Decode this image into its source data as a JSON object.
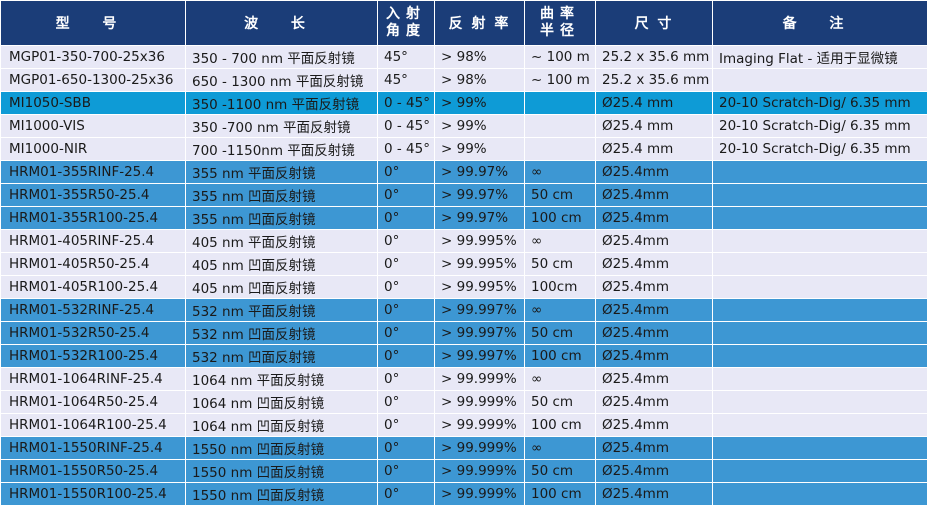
{
  "headers": [
    "型 号",
    "波 长",
    "入射角度",
    "反 射 率",
    "曲率半径",
    "尺 寸",
    "备 注"
  ],
  "header_lines": {
    "angle": [
      "入射",
      "角度"
    ],
    "curvature": [
      "曲率",
      "半径"
    ]
  },
  "rows": [
    {
      "style": "light",
      "cells": [
        "MGP01-350-700-25x36",
        "350 - 700 nm 平面反射镜",
        "45°",
        "> 98%",
        "~ 100 m",
        "25.2 x 35.6 mm",
        "Imaging Flat - 适用于显微镜"
      ]
    },
    {
      "style": "light",
      "cells": [
        "MGP01-650-1300-25x36",
        "650 - 1300 nm 平面反射镜",
        "45°",
        "> 98%",
        "~ 100 m",
        "25.2 x 35.6 mm",
        ""
      ]
    },
    {
      "style": "cyan",
      "cells": [
        "MI1050-SBB",
        "350 -1100 nm 平面反射镜",
        "0 - 45°",
        "> 99%",
        "",
        "Ø25.4 mm",
        "20-10 Scratch-Dig/ 6.35 mm"
      ]
    },
    {
      "style": "light",
      "cells": [
        "MI1000-VIS",
        "350 -700 nm 平面反射镜",
        "0 - 45°",
        "> 99%",
        "",
        "Ø25.4 mm",
        "20-10 Scratch-Dig/ 6.35 mm"
      ]
    },
    {
      "style": "light",
      "cells": [
        "MI1000-NIR",
        "700 -1150nm 平面反射镜",
        "0 - 45°",
        "> 99%",
        "",
        "Ø25.4 mm",
        "20-10 Scratch-Dig/ 6.35 mm"
      ]
    },
    {
      "style": "blue",
      "cells": [
        "HRM01-355RINF-25.4",
        "355 nm 平面反射镜",
        "0°",
        "> 99.97%",
        "∞",
        "Ø25.4mm",
        ""
      ]
    },
    {
      "style": "blue",
      "cells": [
        "HRM01-355R50-25.4",
        "355 nm 凹面反射镜",
        "0°",
        "> 99.97%",
        "50 cm",
        "Ø25.4mm",
        ""
      ]
    },
    {
      "style": "blue",
      "cells": [
        "HRM01-355R100-25.4",
        "355 nm 凹面反射镜",
        "0°",
        "> 99.97%",
        "100 cm",
        "Ø25.4mm",
        ""
      ]
    },
    {
      "style": "light",
      "cells": [
        "HRM01-405RINF-25.4",
        "405 nm 平面反射镜",
        "0°",
        "> 99.995%",
        "∞",
        "Ø25.4mm",
        ""
      ]
    },
    {
      "style": "light",
      "cells": [
        "HRM01-405R50-25.4",
        "405 nm 凹面反射镜",
        "0°",
        "> 99.995%",
        "50 cm",
        "Ø25.4mm",
        ""
      ]
    },
    {
      "style": "light",
      "cells": [
        "HRM01-405R100-25.4",
        "405 nm 凹面反射镜",
        "0°",
        "> 99.995%",
        "100cm",
        "Ø25.4mm",
        ""
      ]
    },
    {
      "style": "blue",
      "cells": [
        "HRM01-532RINF-25.4",
        "532 nm 平面反射镜",
        "0°",
        "> 99.997%",
        "∞",
        "Ø25.4mm",
        ""
      ]
    },
    {
      "style": "blue",
      "cells": [
        "HRM01-532R50-25.4",
        "532 nm 凹面反射镜",
        "0°",
        "> 99.997%",
        "50 cm",
        "Ø25.4mm",
        ""
      ]
    },
    {
      "style": "blue",
      "cells": [
        "HRM01-532R100-25.4",
        "532 nm 凹面反射镜",
        "0°",
        "> 99.997%",
        "100 cm",
        "Ø25.4mm",
        ""
      ]
    },
    {
      "style": "light",
      "cells": [
        "HRM01-1064RINF-25.4",
        "1064 nm 平面反射镜",
        "0°",
        "> 99.999%",
        "∞",
        "Ø25.4mm",
        ""
      ]
    },
    {
      "style": "light",
      "cells": [
        "HRM01-1064R50-25.4",
        "1064 nm 凹面反射镜",
        "0°",
        "> 99.999%",
        "50 cm",
        "Ø25.4mm",
        ""
      ]
    },
    {
      "style": "light",
      "cells": [
        "HRM01-1064R100-25.4",
        "1064 nm 凹面反射镜",
        "0°",
        "> 99.999%",
        "100 cm",
        "Ø25.4mm",
        ""
      ]
    },
    {
      "style": "blue",
      "cells": [
        "HRM01-1550RINF-25.4",
        "1550 nm 凹面反射镜",
        "0°",
        "> 99.999%",
        "∞",
        "Ø25.4mm",
        ""
      ]
    },
    {
      "style": "blue",
      "cells": [
        "HRM01-1550R50-25.4",
        "1550 nm 凹面反射镜",
        "0°",
        "> 99.999%",
        "50 cm",
        "Ø25.4mm",
        ""
      ]
    },
    {
      "style": "blue",
      "cells": [
        "HRM01-1550R100-25.4",
        "1550 nm 凹面反射镜",
        "0°",
        "> 99.999%",
        "100 cm",
        "Ø25.4mm",
        ""
      ]
    }
  ],
  "colors": {
    "header_bg": "#1b3d78",
    "row_light": "#e8e8f6",
    "row_cyan": "#0e9bd6",
    "row_blue": "#3d97d3"
  }
}
